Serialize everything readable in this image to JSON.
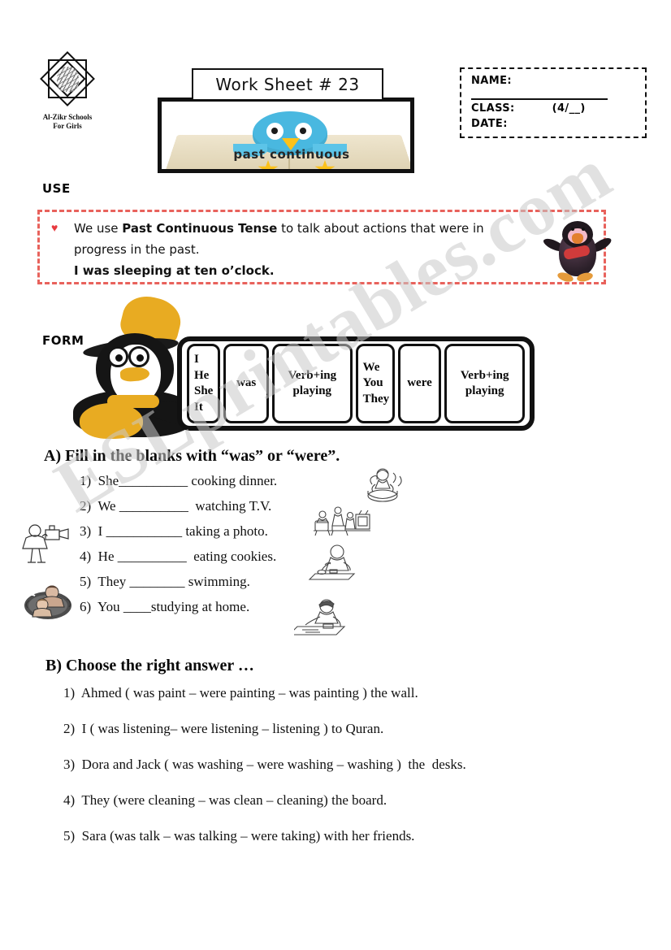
{
  "school": {
    "name_line1": "Al-Zikr Schools",
    "name_line2": "For Girls",
    "logo_icon": "eight-point-star-logo"
  },
  "header": {
    "worksheet_title": "Work Sheet # 23",
    "banner_caption": "past continuous",
    "banner_icon": "blue-bird-on-book"
  },
  "student_info": {
    "name_label": "NAME:",
    "class_label": "CLASS:",
    "class_value": "(4/__)",
    "date_label": "DATE:"
  },
  "use_section": {
    "label": "USE",
    "bullet_icon": "heart-bullet",
    "line1_part1": "We use ",
    "line1_bold": "Past  Continuous  Tense",
    "line1_part2": " to talk about actions that were in",
    "line2": "progress in the past.",
    "line3": "I was sleeping at ten o’clock.",
    "accent_color": "#e8625c",
    "heart_color": "#e8393f",
    "mascot_icon": "penguin-with-bowtie"
  },
  "form_section": {
    "label": "FORM",
    "mascot_icon": "penguin-with-hat",
    "cells": [
      {
        "id": "pronouns-singular",
        "lines": [
          "I",
          "He",
          "She",
          "It"
        ]
      },
      {
        "id": "was",
        "lines": [
          "was"
        ]
      },
      {
        "id": "verb-ing-1",
        "lines": [
          "Verb+ing",
          "playing"
        ]
      },
      {
        "id": "pronouns-plural",
        "lines": [
          "We",
          "You",
          "They"
        ]
      },
      {
        "id": "were",
        "lines": [
          "were"
        ]
      },
      {
        "id": "verb-ing-2",
        "lines": [
          "Verb+ing",
          "playing"
        ]
      }
    ]
  },
  "exercise_a": {
    "heading": "A) Fill in the blanks with “was” or “were”.",
    "questions": [
      "1)  She__________ cooking dinner.",
      "2)  We __________  watching T.V.",
      "3)  I ___________ taking a photo.",
      "4)  He __________  eating cookies.",
      "5)  They ________ swimming.",
      "6)  You ____studying at home."
    ],
    "cliparts": [
      "woman-cooking-pot-icon",
      "family-watching-tv-icon",
      "person-taking-photo-icon",
      "person-eating-cookies-icon",
      "children-swimming-icon",
      "student-studying-icon"
    ]
  },
  "exercise_b": {
    "heading": "B) Choose the right answer …",
    "questions": [
      "1)  Ahmed ( was paint – were painting – was painting ) the wall.",
      "2)  I ( was listening– were listening – listening ) to Quran.",
      "3)  Dora and Jack ( was washing – were washing – washing )  the  desks.",
      "4)  They (were cleaning – was clean – cleaning) the board.",
      "5)  Sara (was talk – was talking – were taking) with her friends."
    ]
  },
  "watermark": {
    "text": "ESLprintables.com",
    "color": "#c9c9c9"
  }
}
